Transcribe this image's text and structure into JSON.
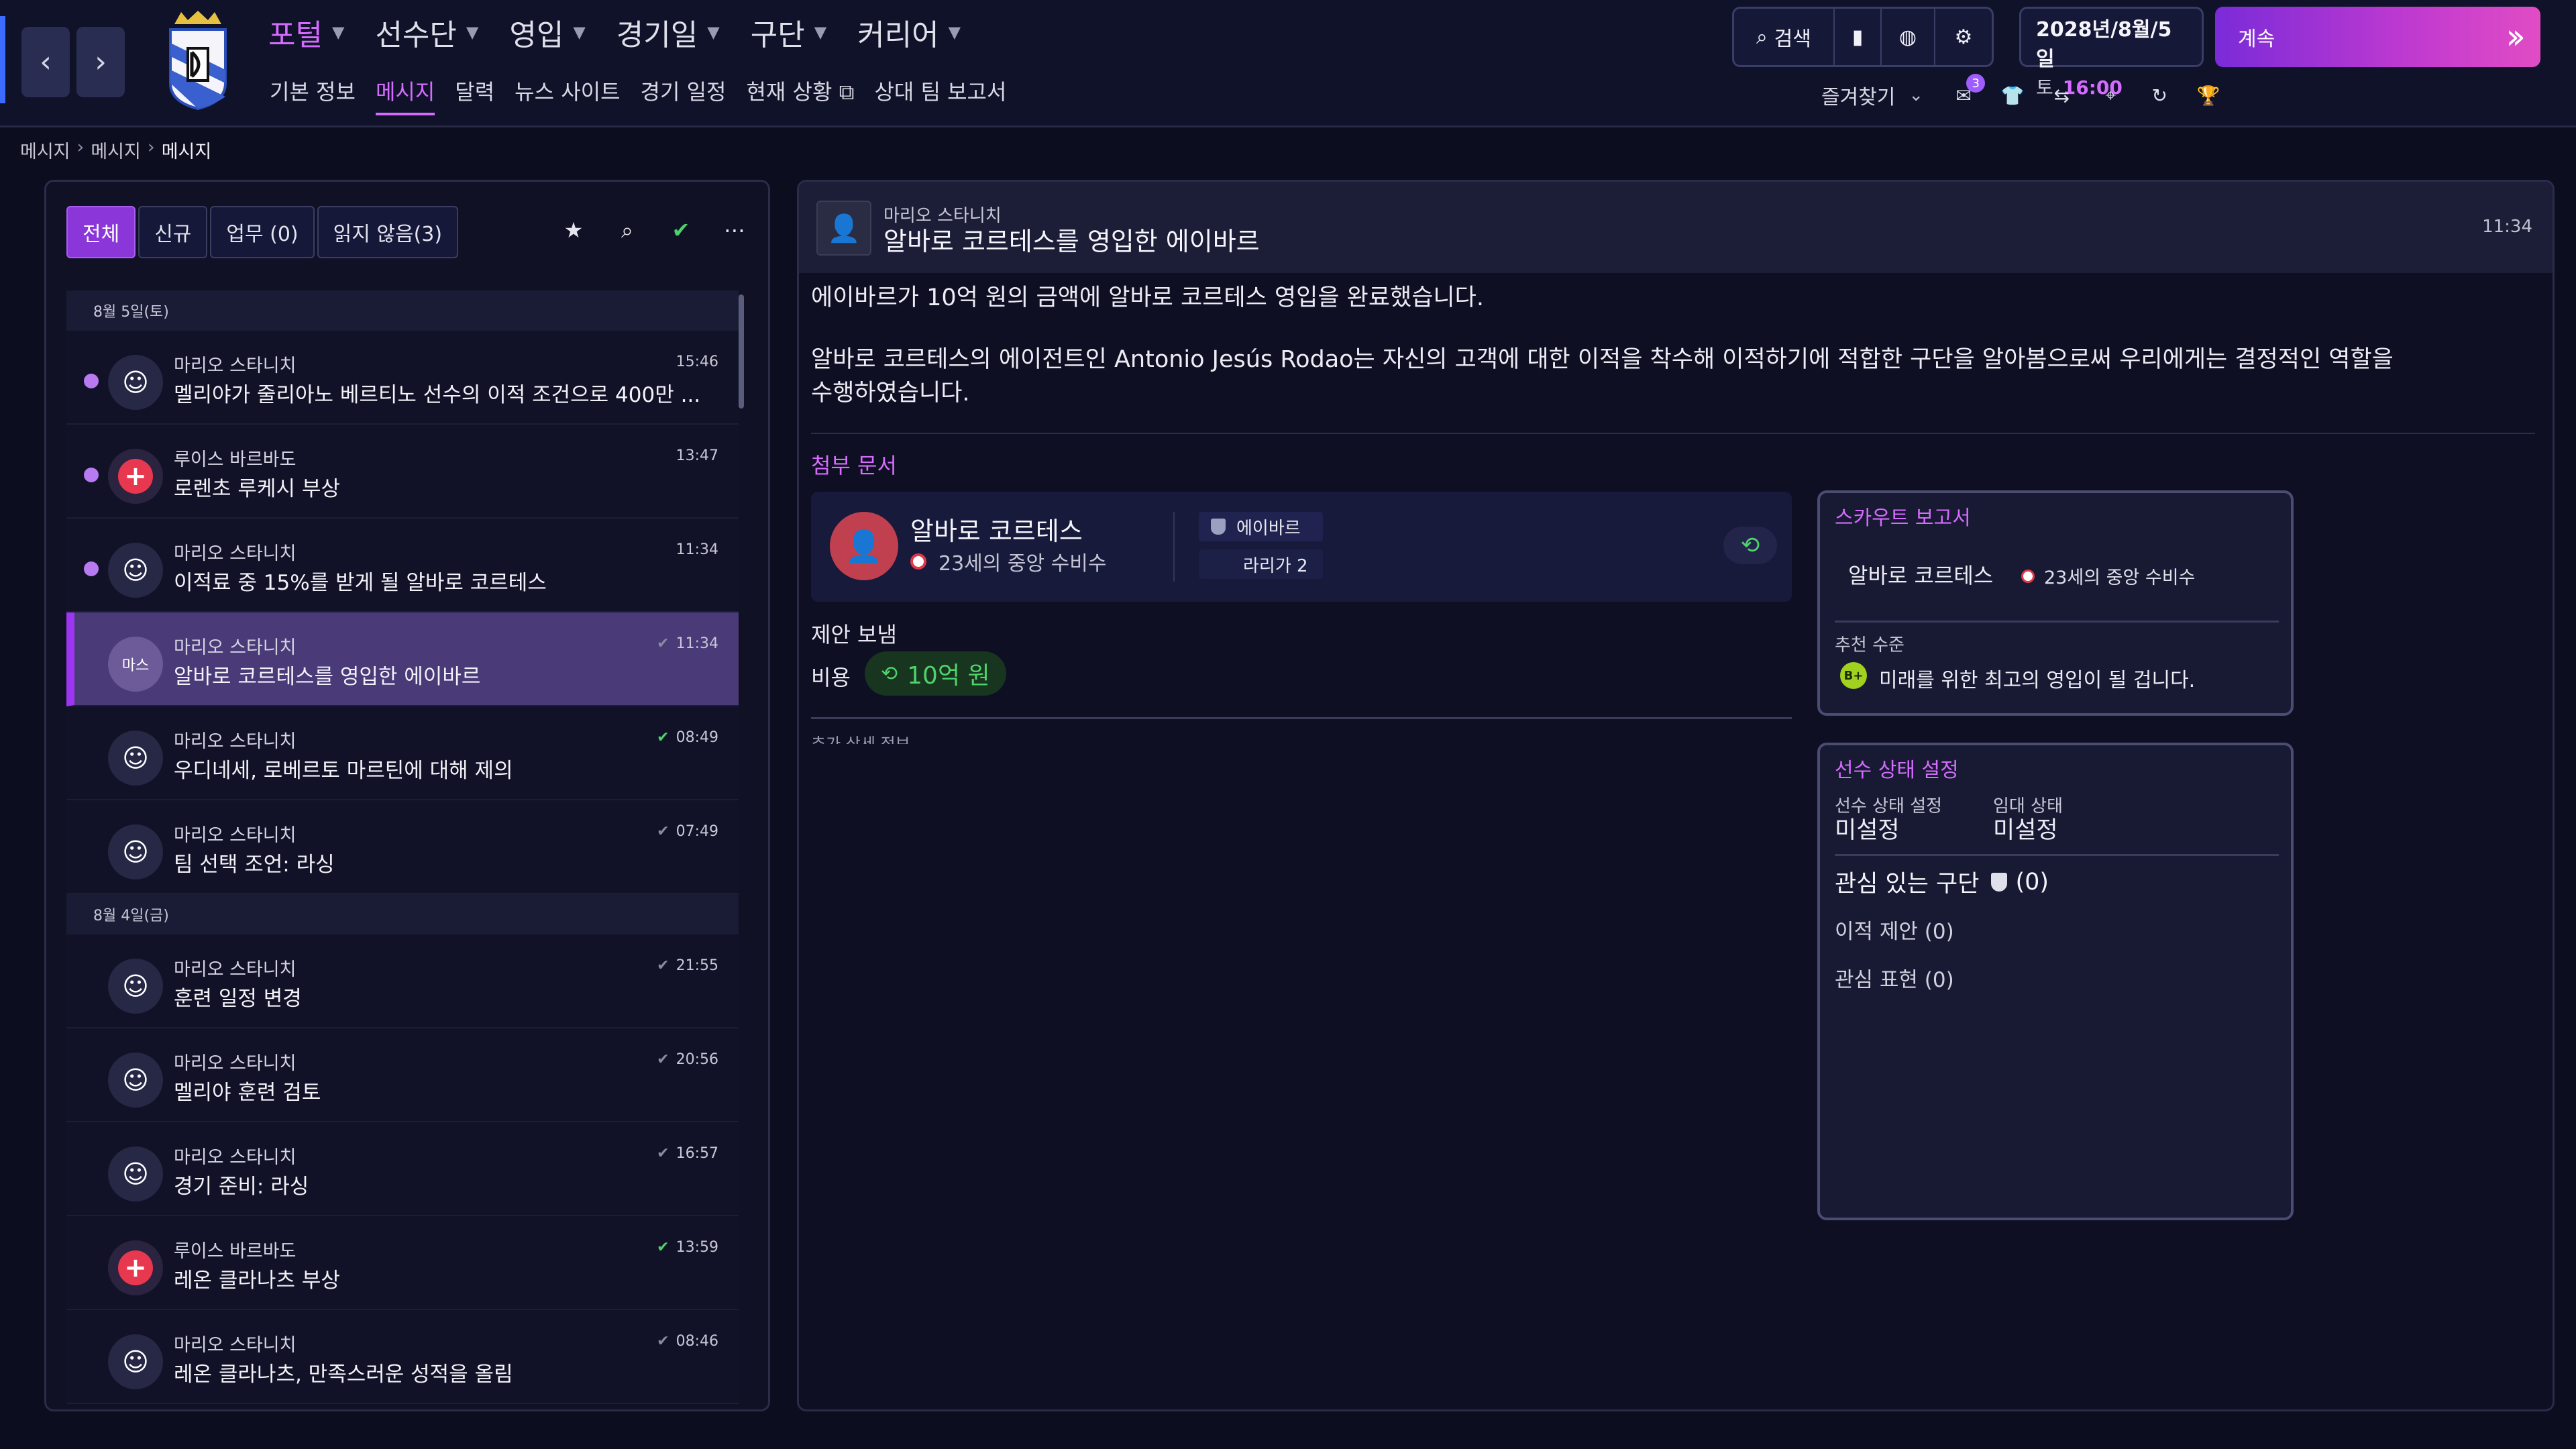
{
  "topbar": {
    "menu": [
      {
        "label": "포털",
        "active": true
      },
      {
        "label": "선수단",
        "active": false
      },
      {
        "label": "영입",
        "active": false
      },
      {
        "label": "경기일",
        "active": false
      },
      {
        "label": "구단",
        "active": false
      },
      {
        "label": "커리어",
        "active": false
      }
    ],
    "submenu": [
      "기본 정보",
      "메시지",
      "달력",
      "뉴스 사이트",
      "경기 일정",
      "현재 상황",
      "상대 팀 보고서"
    ],
    "search_label": "검색",
    "date": "2028년/8월/5일",
    "weekday": "토",
    "time": "16:00",
    "continue_label": "계속",
    "favorites_label": "즐겨찾기",
    "inbox_badge": "3"
  },
  "breadcrumb": [
    "메시지",
    "메시지",
    "메시지"
  ],
  "inbox": {
    "filters": [
      "전체",
      "신규",
      "업무 (0)",
      "읽지 않음(3)"
    ],
    "groups": [
      {
        "date": "8월 5일(토)",
        "messages": [
          {
            "sender": "마리오 스타니치",
            "subject": "멜리야가 줄리아노 베르티노 선수의 이적 조건으로 400만 ...",
            "time": "15:46",
            "unread": true,
            "icon": "staff-icon",
            "read_tick": ""
          },
          {
            "sender": "루이스 바르바도",
            "subject": "로렌초 루케시 부상",
            "time": "13:47",
            "unread": true,
            "icon": "medical-icon",
            "read_tick": ""
          },
          {
            "sender": "마리오 스타니치",
            "subject": "이적료 중 15%를 받게 될 알바로 코르테스",
            "time": "11:34",
            "unread": true,
            "icon": "staff-icon",
            "read_tick": ""
          },
          {
            "sender": "마리오 스타니치",
            "subject": "알바로 코르테스를 영입한 에이바르",
            "time": "11:34",
            "unread": false,
            "icon": "마스",
            "read_tick": "grey",
            "selected": true
          },
          {
            "sender": "마리오 스타니치",
            "subject": "우디네세, 로베르토 마르틴에 대해 제의",
            "time": "08:49",
            "unread": false,
            "icon": "staff-icon",
            "read_tick": "green"
          },
          {
            "sender": "마리오 스타니치",
            "subject": "팀 선택 조언: 라싱",
            "time": "07:49",
            "unread": false,
            "icon": "staff-icon",
            "read_tick": "grey"
          }
        ]
      },
      {
        "date": "8월 4일(금)",
        "messages": [
          {
            "sender": "마리오 스타니치",
            "subject": "훈련 일정 변경",
            "time": "21:55",
            "unread": false,
            "icon": "staff-icon",
            "read_tick": "grey"
          },
          {
            "sender": "마리오 스타니치",
            "subject": "멜리야 훈련 검토",
            "time": "20:56",
            "unread": false,
            "icon": "staff-icon",
            "read_tick": "grey"
          },
          {
            "sender": "마리오 스타니치",
            "subject": "경기 준비: 라싱",
            "time": "16:57",
            "unread": false,
            "icon": "staff-icon",
            "read_tick": "grey"
          },
          {
            "sender": "루이스 바르바도",
            "subject": "레온 클라나츠 부상",
            "time": "13:59",
            "unread": false,
            "icon": "medical-icon",
            "read_tick": "green"
          },
          {
            "sender": "마리오 스타니치",
            "subject": "레온 클라나츠, 만족스러운 성적을 올림",
            "time": "08:46",
            "unread": false,
            "icon": "staff-icon",
            "read_tick": "grey"
          }
        ]
      }
    ]
  },
  "message": {
    "sender": "마리오 스타니치",
    "subject": "알바로 코르테스를 영입한 에이바르",
    "time": "11:34",
    "body": [
      "에이바르가 10억 원의 금액에 알바로 코르테스 영입을 완료했습니다.",
      "알바로 코르테스의 에이전트인 Antonio Jesús Rodao는 자신의 고객에 대한 이적을 착수해 이적하기에 적합한 구단을 알아봄으로써 우리에게는 결정적인 역할을 수행하였습니다."
    ],
    "attachments_label": "첨부 문서",
    "player": {
      "name": "알바로 코르테스",
      "position": "23세의 중앙 수비수",
      "club": "에이바르",
      "league": "라리가 2"
    },
    "offer_label": "제안 보냄",
    "cost_label": "비용",
    "cost_value": "10억 원",
    "extra_label": "추가 상세 정보"
  },
  "scout_report": {
    "title": "스카우트 보고서",
    "player_name": "알바로 코르테스",
    "position": "23세의 중앙 수비수",
    "recommendation_label": "추천 수준",
    "grade": "B+",
    "recommendation": "미래를 위한 최고의 영입이 될 겁니다."
  },
  "player_status": {
    "title": "선수 상태 설정",
    "status_label": "선수 상태 설정",
    "status_value": "미설정",
    "loan_label": "임대 상태",
    "loan_value": "미설정",
    "interested_label": "관심 있는 구단",
    "interested_count": "(0)",
    "transfer_offers": "이적 제안 (0)",
    "expressions": "관심 표현 (0)"
  },
  "colors": {
    "accent": "#d66bff",
    "selected_row": "#4a3a78",
    "positive": "#4fd26a",
    "injury": "#e8384f"
  }
}
